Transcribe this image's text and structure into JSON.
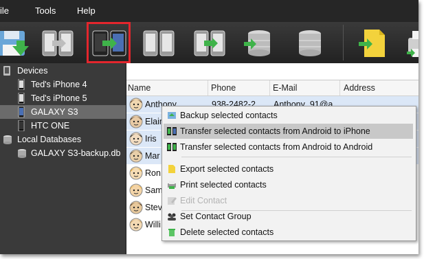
{
  "menu": {
    "file": "ile",
    "tools": "Tools",
    "help": "Help"
  },
  "toolbar": {
    "buttons": [
      {
        "icon": "save-icon"
      },
      {
        "icon": "transfer-icon"
      },
      {
        "icon": "android-to-iphone-icon"
      },
      {
        "icon": "phones-icon"
      },
      {
        "icon": "transfer-android-icon"
      },
      {
        "icon": "database-import-icon"
      },
      {
        "icon": "database-icon"
      },
      {
        "icon": "export-file-icon"
      },
      {
        "icon": "print-icon"
      }
    ]
  },
  "sidebar": {
    "devices_label": "Devices",
    "devices": [
      {
        "label": "Ted's iPhone 4"
      },
      {
        "label": "Ted's iPhone 5"
      },
      {
        "label": "GALAXY S3"
      },
      {
        "label": "HTC ONE"
      }
    ],
    "local_label": "Local Databases",
    "databases": [
      {
        "label": "GALAXY S3-backup.db"
      }
    ]
  },
  "table": {
    "columns": [
      "Name",
      "Phone",
      "E-Mail",
      "Address"
    ],
    "rows": [
      {
        "name": "Anthony",
        "phone": "938-2482-2",
        "email": "Anthony_91@a"
      },
      {
        "name": "Elain",
        "phone": "",
        "email": ""
      },
      {
        "name": "Iris",
        "phone": "",
        "email": ""
      },
      {
        "name": "Mar",
        "phone": "",
        "email": ""
      },
      {
        "name": "Ron",
        "phone": "",
        "email": ""
      },
      {
        "name": "Sam",
        "phone": "",
        "email": ""
      },
      {
        "name": "Stev",
        "phone": "",
        "email": ""
      },
      {
        "name": "Willi",
        "phone": "",
        "email": ""
      }
    ]
  },
  "context_menu": {
    "items": [
      {
        "label": "Backup selected contacts",
        "icon": "backup-icon"
      },
      {
        "label": "Transfer selected contacts from Android to iPhone",
        "icon": "android-to-iphone-icon"
      },
      {
        "label": "Transfer selected contacts from Android to Android",
        "icon": "android-to-android-icon"
      },
      {
        "label": "Export selected contacts",
        "icon": "export-icon"
      },
      {
        "label": "Print selected contacts",
        "icon": "print-icon"
      },
      {
        "label": "Edit Contact",
        "icon": "edit-icon"
      },
      {
        "label": "Set Contact Group",
        "icon": "group-icon"
      },
      {
        "label": "Delete selected contacts",
        "icon": "delete-icon"
      }
    ]
  },
  "colors": {
    "highlight_border": "#e4262d",
    "selected_row": "#dbe7f7",
    "menu_hover": "#c8c8c8"
  }
}
